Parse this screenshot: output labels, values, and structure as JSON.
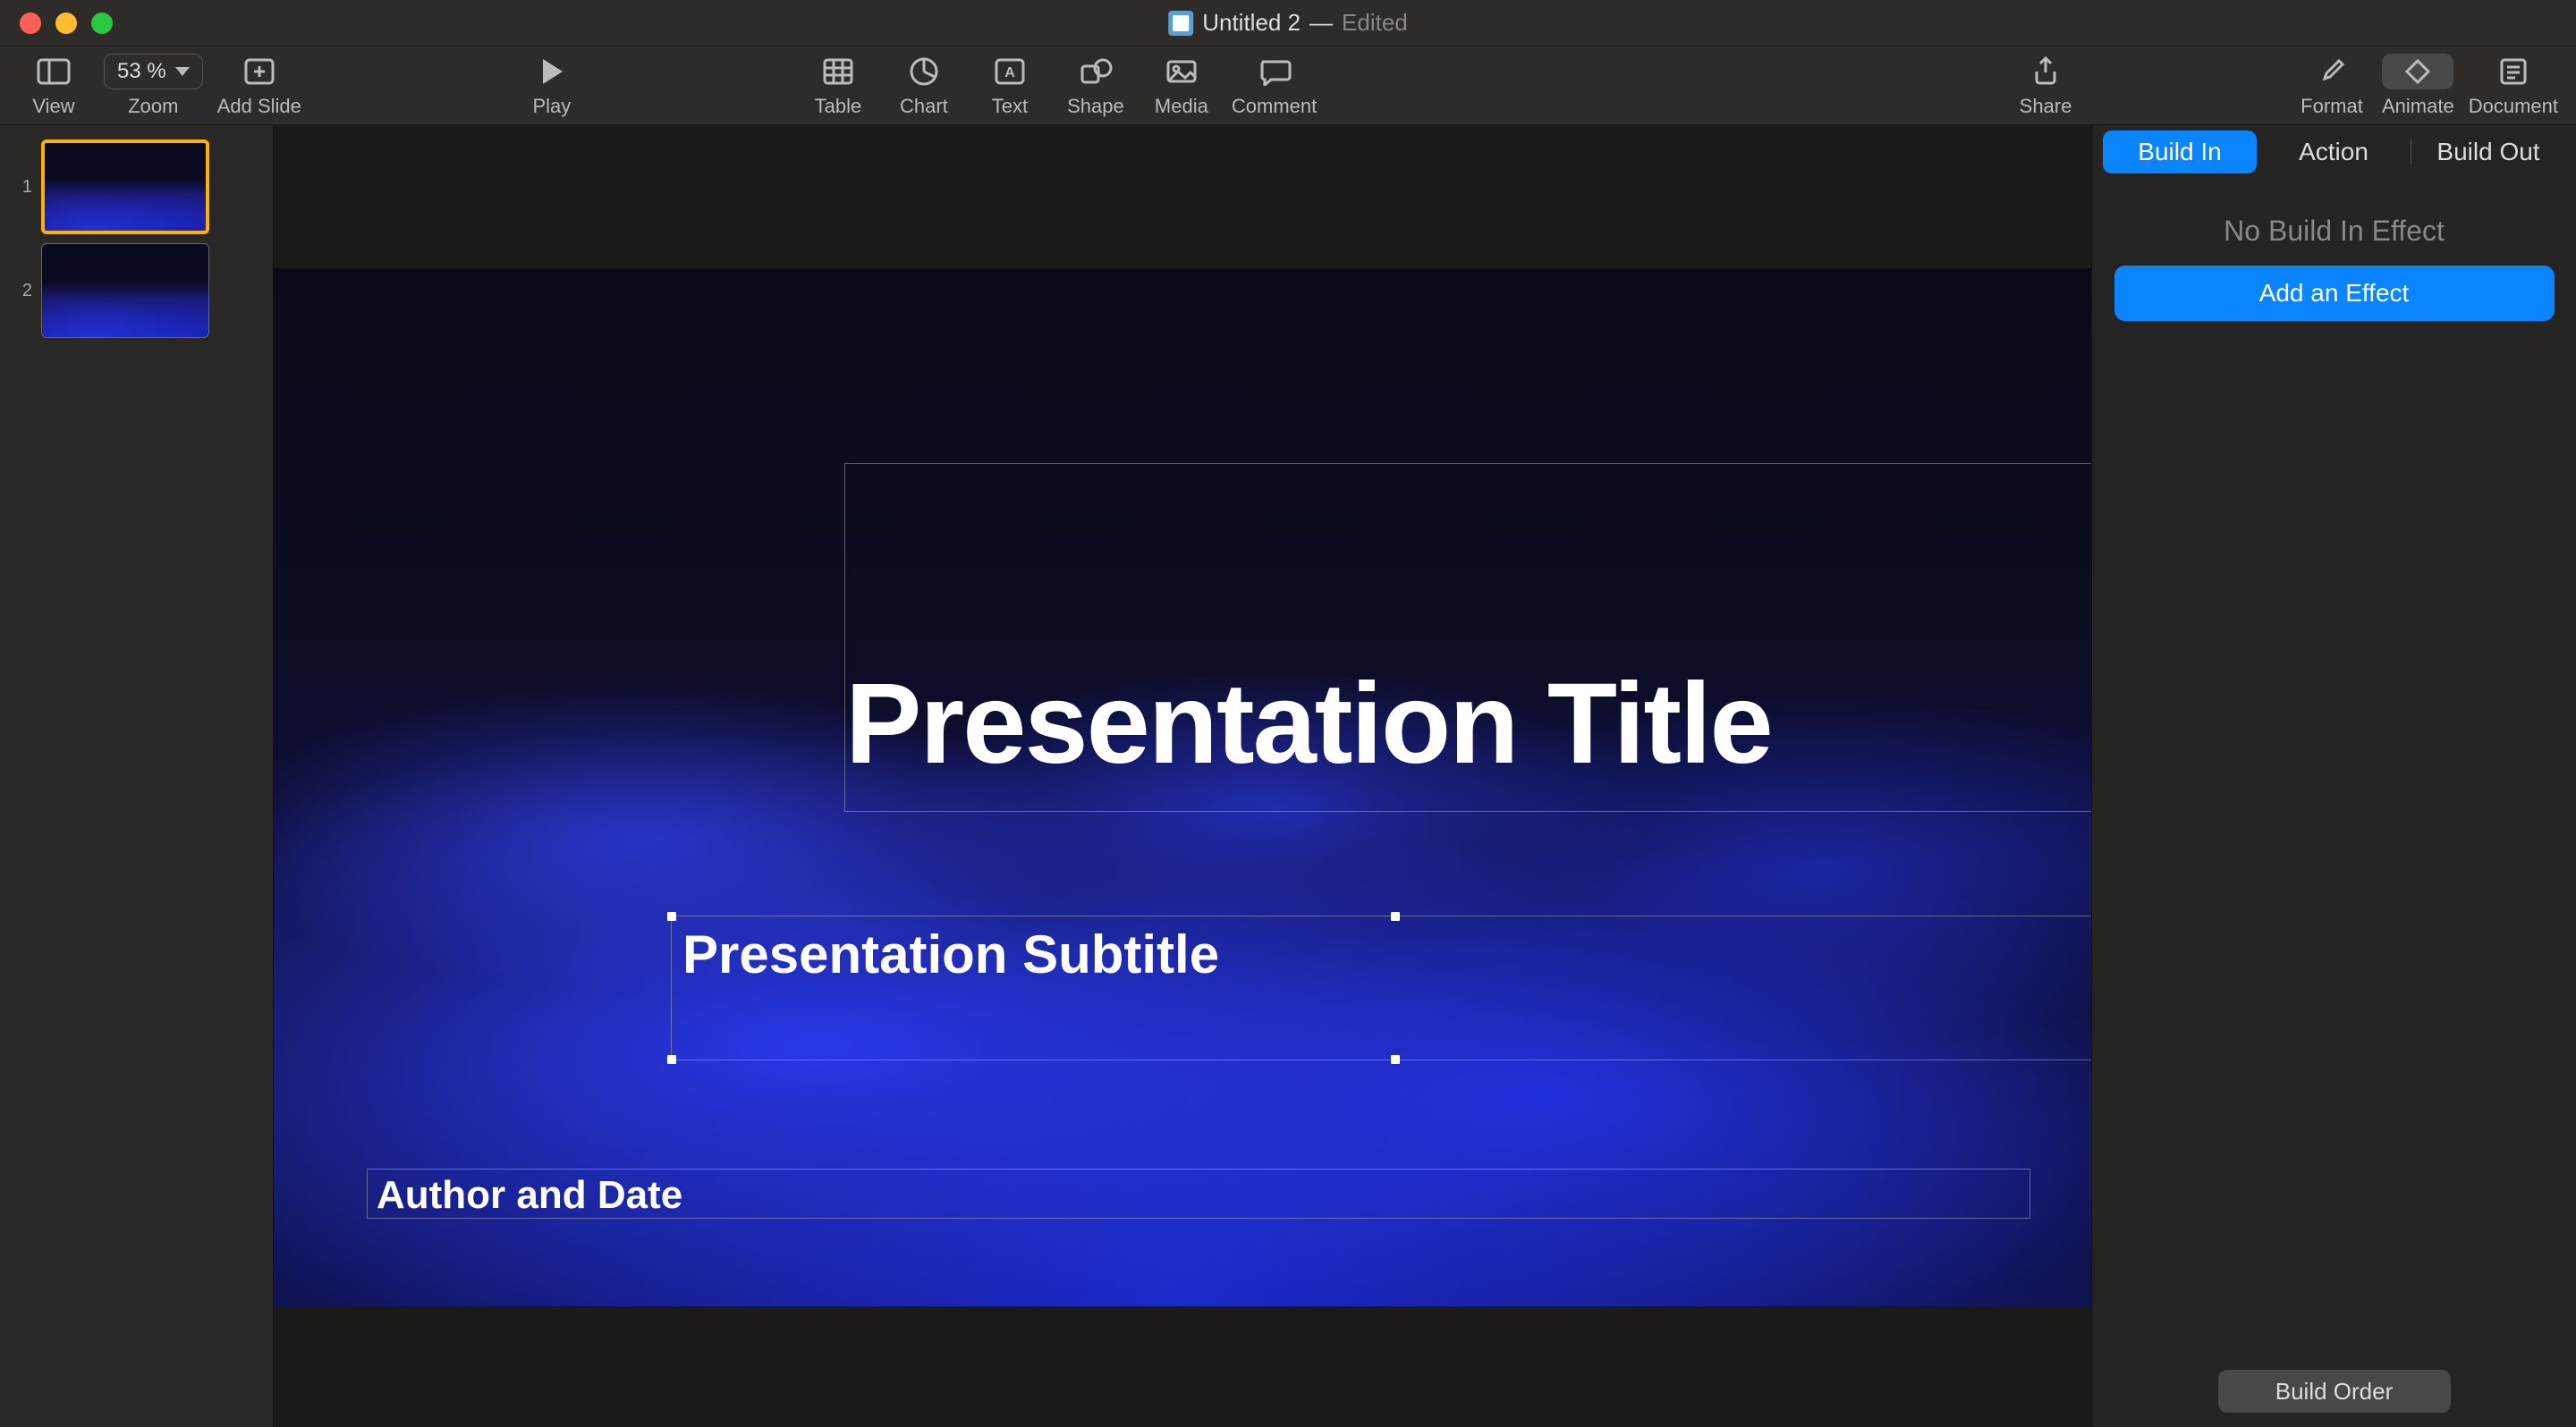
{
  "window": {
    "title": "Untitled 2",
    "separator": " — ",
    "status": "Edited"
  },
  "toolbar": {
    "view": "View",
    "zoom": "Zoom",
    "zoom_value": "53 %",
    "add_slide": "Add Slide",
    "play": "Play",
    "table": "Table",
    "chart": "Chart",
    "text": "Text",
    "shape": "Shape",
    "media": "Media",
    "comment": "Comment",
    "share": "Share",
    "format": "Format",
    "animate": "Animate",
    "document": "Document"
  },
  "navigator": {
    "slides": [
      {
        "num": "1"
      },
      {
        "num": "2"
      }
    ]
  },
  "slide": {
    "title": "Presentation Title",
    "subtitle": "Presentation Subtitle",
    "author": "Author and Date"
  },
  "inspector": {
    "tabs": {
      "build_in": "Build In",
      "action": "Action",
      "build_out": "Build Out"
    },
    "no_effect": "No Build In Effect",
    "add_effect": "Add an Effect",
    "build_order": "Build Order"
  }
}
